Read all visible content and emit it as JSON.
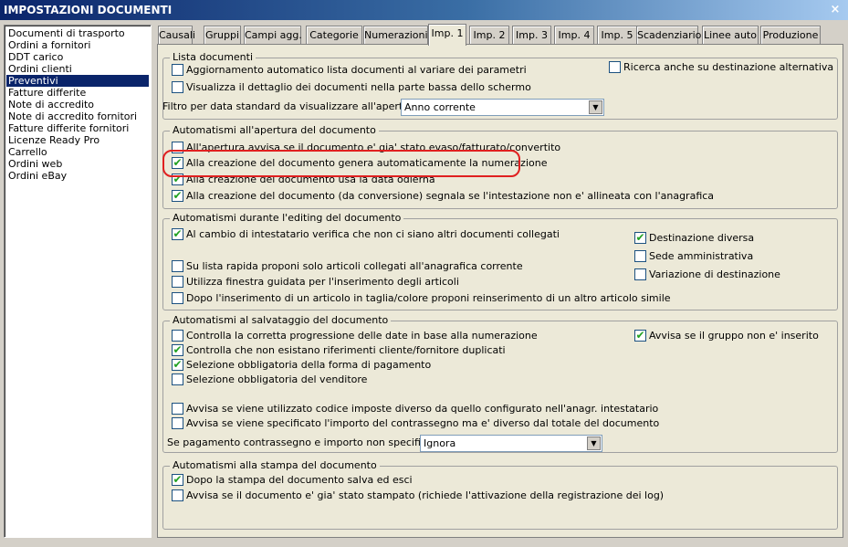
{
  "window": {
    "title": "IMPOSTAZIONI DOCUMENTI",
    "close_glyph": "×"
  },
  "sidebar": {
    "items": [
      "Documenti di trasporto",
      "Ordini a fornitori",
      "DDT carico",
      "Ordini clienti",
      "Preventivi",
      "Fatture differite",
      "Note di accredito",
      "Note di accredito fornitori",
      "Fatture differite fornitori",
      "Licenze Ready Pro",
      "Carrello",
      "Ordini web",
      "Ordini eBay"
    ],
    "selected_index": 4
  },
  "tabs": [
    "Causali",
    "Gruppi",
    "Campi agg.",
    "Categorie",
    "Numerazioni",
    "Imp. 1",
    "Imp. 2",
    "Imp. 3",
    "Imp. 4",
    "Imp. 5",
    "Scadenziario",
    "Linee auto",
    "Produzione"
  ],
  "active_tab_index": 5,
  "groups": {
    "lista": {
      "title": "Lista documenti",
      "auto_update": {
        "label": "Aggiornamento automatico lista documenti al variare dei parametri",
        "checked": false
      },
      "show_detail": {
        "label": "Visualizza il dettaglio dei documenti nella parte bassa dello schermo",
        "checked": false
      },
      "alt_dest": {
        "label": "Ricerca anche su destinazione alternativa",
        "checked": false
      },
      "filter_label": "Filtro per data standard da visualizzare all'apertura :",
      "filter_value": "Anno corrente"
    },
    "apertura": {
      "title": "Automatismi all'apertura del documento",
      "warn_evaded": {
        "label": "All'apertura avvisa se il documento e' gia' stato evaso/fatturato/convertito",
        "checked": false
      },
      "auto_numbering": {
        "label": "Alla creazione del documento genera automaticamente la numerazione",
        "checked": true
      },
      "use_today": {
        "label": "Alla creazione del documento usa la data odierna",
        "checked": true
      },
      "warn_header": {
        "label": "Alla creazione del documento (da conversione) segnala se l'intestazione non e' allineata con l'anagrafica",
        "checked": true
      }
    },
    "editing": {
      "title": "Automatismi durante l'editing del documento",
      "check_linked": {
        "label": "Al cambio di intestatario verifica che non ci siano altri documenti collegati",
        "checked": true
      },
      "dest_diversa": {
        "label": "Destinazione diversa",
        "checked": true
      },
      "sede_amm": {
        "label": "Sede amministrativa",
        "checked": false
      },
      "var_dest": {
        "label": "Variazione di destinazione",
        "checked": false
      },
      "quick_list": {
        "label": "Su lista rapida proponi solo articoli collegati all'anagrafica corrente",
        "checked": false
      },
      "guided": {
        "label": "Utilizza finestra guidata per l'inserimento degli articoli",
        "checked": false
      },
      "size_color": {
        "label": "Dopo l'inserimento di un articolo in taglia/colore proponi reinserimento di un altro articolo simile",
        "checked": false
      }
    },
    "salvataggio": {
      "title": "Automatismi al salvataggio del documento",
      "check_dates": {
        "label": "Controlla la corretta progressione delle date in base alla numerazione",
        "checked": false
      },
      "warn_group": {
        "label": "Avvisa se il gruppo non e' inserito",
        "checked": true
      },
      "check_dup": {
        "label": "Controlla che non esistano riferimenti cliente/fornitore duplicati",
        "checked": true
      },
      "payment_req": {
        "label": "Selezione obbligatoria della forma di pagamento",
        "checked": true
      },
      "seller_req": {
        "label": "Selezione obbligatoria del venditore",
        "checked": false
      },
      "tax_code": {
        "label": "Avvisa se viene utilizzato codice imposte diverso da quello configurato nell'anagr. intestatario",
        "checked": false
      },
      "cod_amount": {
        "label": "Avvisa se viene specificato l'importo del contrassegno ma e' diverso dal totale del documento",
        "checked": false
      },
      "cod_label": "Se pagamento contrassegno e importo non specificato :",
      "cod_value": "Ignora"
    },
    "stampa": {
      "title": "Automatismi alla stampa del documento",
      "save_exit": {
        "label": "Dopo la stampa del documento salva ed esci",
        "checked": true
      },
      "warn_printed": {
        "label": "Avvisa se il documento e' gia' stato stampato (richiede l'attivazione della registrazione dei log)",
        "checked": false
      }
    }
  },
  "colors": {
    "highlight": "#e02020",
    "check": "#21a121",
    "selection": "#0a246a"
  }
}
